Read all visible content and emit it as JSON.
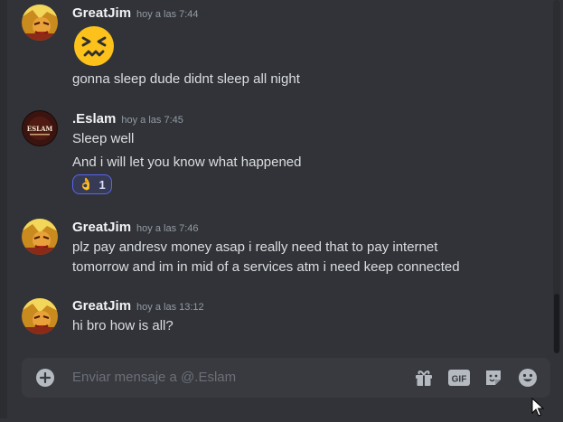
{
  "messages": [
    {
      "author": "GreatJim",
      "time": "hoy a las 7:44",
      "emoji": "confounded-face",
      "text": "gonna sleep dude didnt sleep all night"
    },
    {
      "author": ".Eslam",
      "time": "hoy a las 7:45",
      "avatar_text": "ESLAM",
      "lines": [
        "Sleep well",
        "And i will let you know what happened"
      ],
      "reaction": {
        "emoji": "👌",
        "count": "1"
      }
    },
    {
      "author": "GreatJim",
      "time": "hoy a las 7:46",
      "lines": [
        "plz pay andresv money asap i really need that to pay internet",
        "tomorrow and im in mid of a services atm i need keep connected"
      ]
    },
    {
      "author": "GreatJim",
      "time": "hoy a las 13:12",
      "text": "hi bro how is all?"
    }
  ],
  "composer": {
    "placeholder": "Enviar mensaje a @.Eslam",
    "gif_label": "GIF",
    "icons": [
      "plus-circle-icon",
      "gift-icon",
      "gif-icon",
      "sticker-icon",
      "emoji-icon"
    ]
  },
  "colors": {
    "background": "#313338",
    "composer": "#383a40",
    "reaction_border": "#5865f2",
    "author": "#f2f3f5",
    "timestamp": "#949ba4"
  }
}
